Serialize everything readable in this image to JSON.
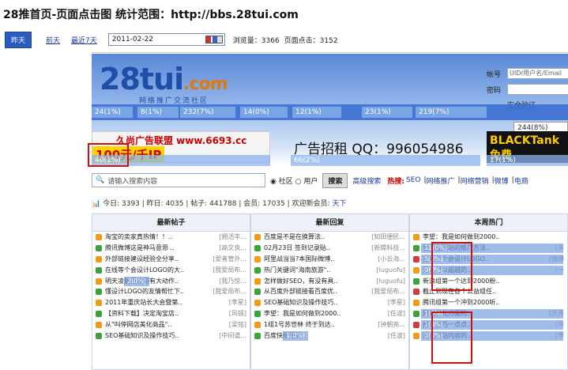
{
  "title": "28推首页-页面点击图 统计范围：http://bbs.28tui.com",
  "toolbar": {
    "today": "昨天",
    "day_before": "前天",
    "last7": "最近7天",
    "date_value": "2011-02-22",
    "views": "浏览量：3366",
    "clicks": "页面点击：3152"
  },
  "site": {
    "logo_main": "28tui",
    "logo_com": ".com",
    "logo_sub": "网络推广交流社区",
    "login": {
      "account_label": "帐号",
      "account_placeholder": "UID/用户名/Email",
      "password_label": "密码",
      "verify_label": "安全验证"
    },
    "nav_heat": [
      "24(1%)",
      "8(1%)",
      "232(7%)",
      "14(0%)",
      "12(1%)",
      "23(1%)",
      "219(7%)",
      "244(8%)"
    ],
    "ad_heat": [
      "40(1%)",
      "66(2%)",
      "17(1%)"
    ],
    "ad1_line1": "久尚广告联盟 www.6693.cc",
    "ad1_line2": "100元/千IP",
    "ad2": "广告招租 QQ：996054986",
    "ad3": "BLACKTank 免费",
    "search": {
      "placeholder": "请输入搜索内容",
      "scope_forum": "社区",
      "scope_user": "用户",
      "button": "搜索",
      "advanced": "高级搜索",
      "hot_label": "热搜:",
      "hot": [
        "SEO",
        "网络推广",
        "网络营销",
        "微博",
        "电商"
      ]
    },
    "stats": {
      "today": "今日: 3393",
      "yesterday": "昨日: 4035",
      "posts": "帖子: 441788",
      "members": "会员: 17035",
      "welcome": "欢迎新会员:",
      "newest": "天下"
    },
    "columns": [
      {
        "title": "最新帖子",
        "items": [
          {
            "text": "淘宝的卖家真热情！！..",
            "author": "[拥活丰..."
          },
          {
            "text": "腾讯微博这是神马意思 ..",
            "author": "[高文良..."
          },
          {
            "text": "外部链接建设经验全分享..",
            "author": "[爱者管外..."
          },
          {
            "text": "在线等个会设计LOGO的大..",
            "author": "[我爱局布..."
          },
          {
            "text": "明天凌晨百度哥有大动作..",
            "author": "[我乃惊...",
            "heat": "2(0%)"
          },
          {
            "text": "懂设计LOGO的友情帮忙下..",
            "author": "[我爱局布..."
          },
          {
            "text": "2011年重庆站长大会暨第..",
            "author": "[李星]"
          },
          {
            "text": "【资料下载】决定淘宝店..",
            "author": "[风镜]"
          },
          {
            "text": "从\"叫停网店美化商品\"..",
            "author": "[梁铭]"
          },
          {
            "text": "SEO基础知识及操作技巧..",
            "author": "[中间道..."
          }
        ]
      },
      {
        "title": "最新回复",
        "items": [
          {
            "text": "百度是不是在换算法..",
            "author": "[知田便民..."
          },
          {
            "text": "02月23日 签到记录贴..",
            "author": "[新嫦科技..."
          },
          {
            "text": "阿里战当当?本国际微博..",
            "author": "[小云海..."
          },
          {
            "text": "热门关键词\"海南旅游\"..",
            "author": "[luguofu]"
          },
          {
            "text": "怎样做好SEO，有没有具..",
            "author": "[luguofu]"
          },
          {
            "text": "从百度外部链接看百度优..",
            "author": "[我爱局布..."
          },
          {
            "text": "SEO基础知识及操作技巧..",
            "author": "[李星]"
          },
          {
            "text": "李望：我是如何做到2000..",
            "author": "[任波]"
          },
          {
            "text": "1组1号苏世林 终于到达..",
            "author": "[钟朝亮..."
          },
          {
            "text": "百度快照更新..",
            "author": "[任波]",
            "heat": "1(0%)"
          }
        ]
      },
      {
        "title": "本周热门",
        "items": [
          {
            "text": "李望：我是如何做到2000..",
            "author": ""
          },
          {
            "text": "生活圈网站的推广方法..",
            "author": "[羊",
            "heat": "11(0%)"
          },
          {
            "text": "在线等个会设计LOGO..",
            "author": "[微博",
            "heat": "5(0%)"
          },
          {
            "text": "无人可以超越的..",
            "author": "[一",
            "heat": "9(0%)"
          },
          {
            "text": "新浪组第一个达到2000粉..",
            "author": ""
          },
          {
            "text": "截止到现在各个公益组任..",
            "author": ""
          },
          {
            "text": "腾讯组第一个冲到2000听..",
            "author": ""
          },
          {
            "text": "网站优化方面的..",
            "author": "[乐秀",
            "heat": "1(0%)"
          },
          {
            "text": "推广技巧一点点..",
            "author": "[中",
            "heat": "1(0%)"
          },
          {
            "text": "浅谈网站内容的..",
            "author": "[李",
            "heat": "3(0%)"
          }
        ]
      }
    ]
  }
}
